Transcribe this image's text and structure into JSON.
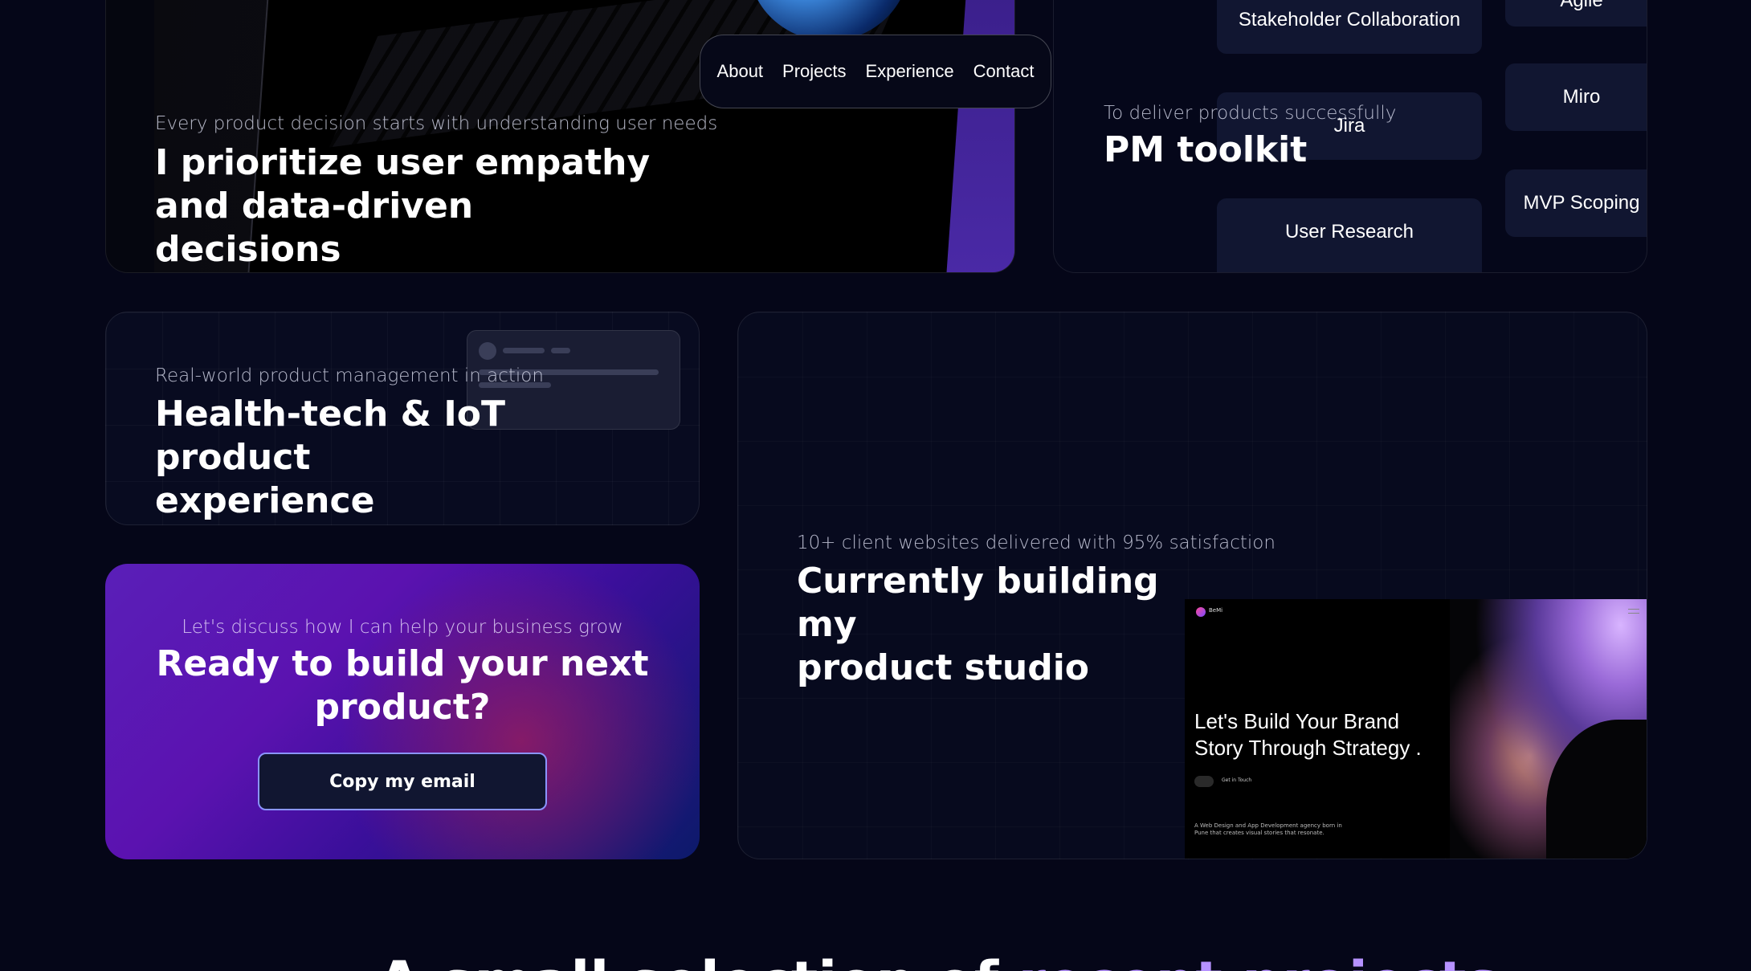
{
  "nav": {
    "items": [
      "About",
      "Projects",
      "Experience",
      "Contact"
    ]
  },
  "empathy_card": {
    "subtitle": "Every product decision starts with understanding user needs",
    "title_line1": "I prioritize user empathy",
    "title_line2": "and data-driven decisions"
  },
  "toolkit_card": {
    "subtitle": "To deliver products successfully",
    "title": "PM toolkit",
    "chips": [
      "Stakeholder Collaboration",
      "Jira",
      "User Research",
      "Agile",
      "Miro",
      "MVP Scoping"
    ]
  },
  "health_card": {
    "subtitle": "Real-world product management in action",
    "title_line1": "Health-tech & IoT product",
    "title_line2": "experience"
  },
  "cta_card": {
    "subtitle": "Let's discuss how I can help your business grow",
    "title_line1": "Ready to build your next",
    "title_line2": "product?",
    "button": "Copy my email"
  },
  "studio_card": {
    "subtitle": "10+ client websites delivered with 95% satisfaction",
    "title_line1": "Currently building my",
    "title_line2": "product studio",
    "screenshot": {
      "logo": "BeMi",
      "headline_line1": "Let's Build Your Brand",
      "headline_line2": "Story Through Strategy .",
      "cta": "Get in Touch",
      "description": "A Web Design and App Development agency born in Pune that creates visual stories that resonate."
    }
  },
  "bottom_heading": {
    "text": "A small selection of",
    "accent": "recent projects"
  },
  "colors": {
    "background": "#050618",
    "card": "#070a1e",
    "chip": "#111631",
    "accent": "#b692ff",
    "button_border": "#8a94ff"
  }
}
